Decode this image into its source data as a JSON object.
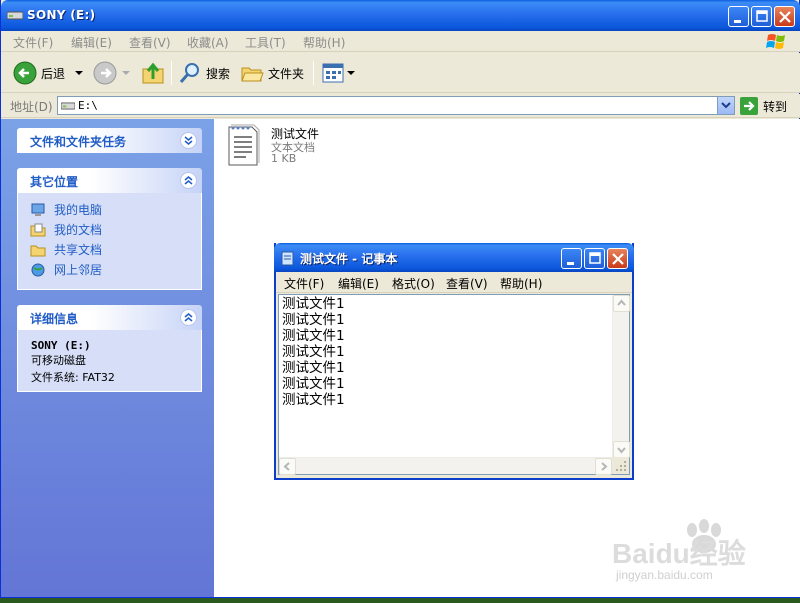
{
  "explorer": {
    "title": "SONY (E:)",
    "menu": [
      "文件(F)",
      "编辑(E)",
      "查看(V)",
      "收藏(A)",
      "工具(T)",
      "帮助(H)"
    ],
    "toolbar": {
      "back": "后退",
      "search": "搜索",
      "folders": "文件夹"
    },
    "address": {
      "label": "地址(D)",
      "value": "E:\\",
      "go": "转到"
    }
  },
  "tasks": {
    "file_tasks_title": "文件和文件夹任务",
    "other_places_title": "其它位置",
    "other_places": [
      "我的电脑",
      "我的文档",
      "共享文档",
      "网上邻居"
    ],
    "details_title": "详细信息",
    "details": {
      "name": "SONY (E:)",
      "type": "可移动磁盘",
      "fs": "文件系统: FAT32"
    }
  },
  "file": {
    "name": "测试文件",
    "type": "文本文档",
    "size": "1 KB"
  },
  "notepad": {
    "title": "测试文件 - 记事本",
    "menu": [
      "文件(F)",
      "编辑(E)",
      "格式(O)",
      "查看(V)",
      "帮助(H)"
    ],
    "lines": [
      "测试文件1",
      "测试文件1",
      "测试文件1",
      "测试文件1",
      "测试文件1",
      "测试文件1",
      "测试文件1"
    ]
  },
  "watermark": {
    "brand": "Baidu经验",
    "url": "jingyan.baidu.com"
  },
  "icons": [
    "drive-icon",
    "back-arrow-icon",
    "forward-arrow-icon",
    "up-folder-icon",
    "search-icon",
    "folders-icon",
    "views-icon",
    "go-icon",
    "notepad-icon"
  ]
}
